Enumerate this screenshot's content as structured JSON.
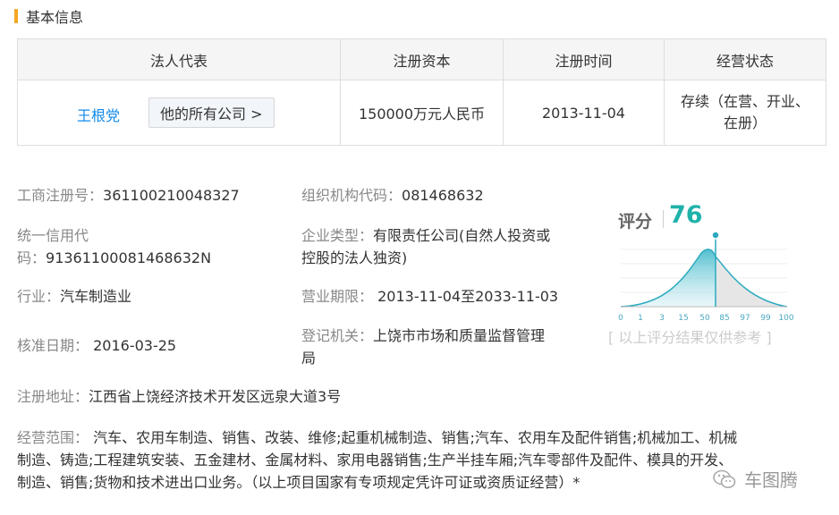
{
  "section": {
    "title": "基本信息"
  },
  "table": {
    "headers": [
      "法人代表",
      "注册资本",
      "注册时间",
      "经营状态"
    ],
    "legal_rep": "王根党",
    "all_companies_label": "他的所有公司 >",
    "registered_capital": "150000万元人民币",
    "registration_date": "2013-11-04",
    "business_status": "存续（在营、开业、在册）"
  },
  "fields": {
    "reg_no_label": "工商注册号：",
    "reg_no": "361100210048327",
    "org_code_label": "组织机构代码：",
    "org_code": "081468632",
    "credit_code_label_1": "统一信用代",
    "credit_code_label_2": "码：",
    "credit_code": "91361100081468632N",
    "company_type_label": "企业类型：",
    "company_type_1": "有限责任公司(自然人投资或",
    "company_type_2": "控股的法人独资)",
    "industry_label": "行业：",
    "industry": "汽车制造业",
    "term_label": "营业期限：",
    "term": " 2013-11-04至2033-11-03",
    "approval_label": "核准日期：",
    "approval_date": " 2016-03-25",
    "authority_label": "登记机关：",
    "authority_1": "上饶市市场和质量监督管理",
    "authority_2": "局",
    "address_label": "注册地址：",
    "address": "江西省上饶经济技术开发区远泉大道3号",
    "scope_label": "经营范围：",
    "scope_1": " 汽车、农用车制造、销售、改装、维修;起重机械制造、销售;汽车、农用车及配件销售;机械加工、机械",
    "scope_2": "制造、铸造;工程建筑安装、五金建材、金属材料、家用电器销售;生产半挂车厢;汽车零部件及配件、模具的开发、",
    "scope_3": "制造、销售;货物和技术进出口业务。（以上项目国家有专项规定凭许可证或资质证经营）*"
  },
  "score": {
    "label": "评分",
    "value": "76",
    "ticks": [
      "0",
      "1",
      "3",
      "15",
      "50",
      "85",
      "97",
      "99",
      "100"
    ],
    "note": "[ 以上评分结果仅供参考 ]",
    "accent_color": "#20b2aa"
  },
  "watermark": {
    "text": "车图腾",
    "icon": "wechat-icon"
  }
}
